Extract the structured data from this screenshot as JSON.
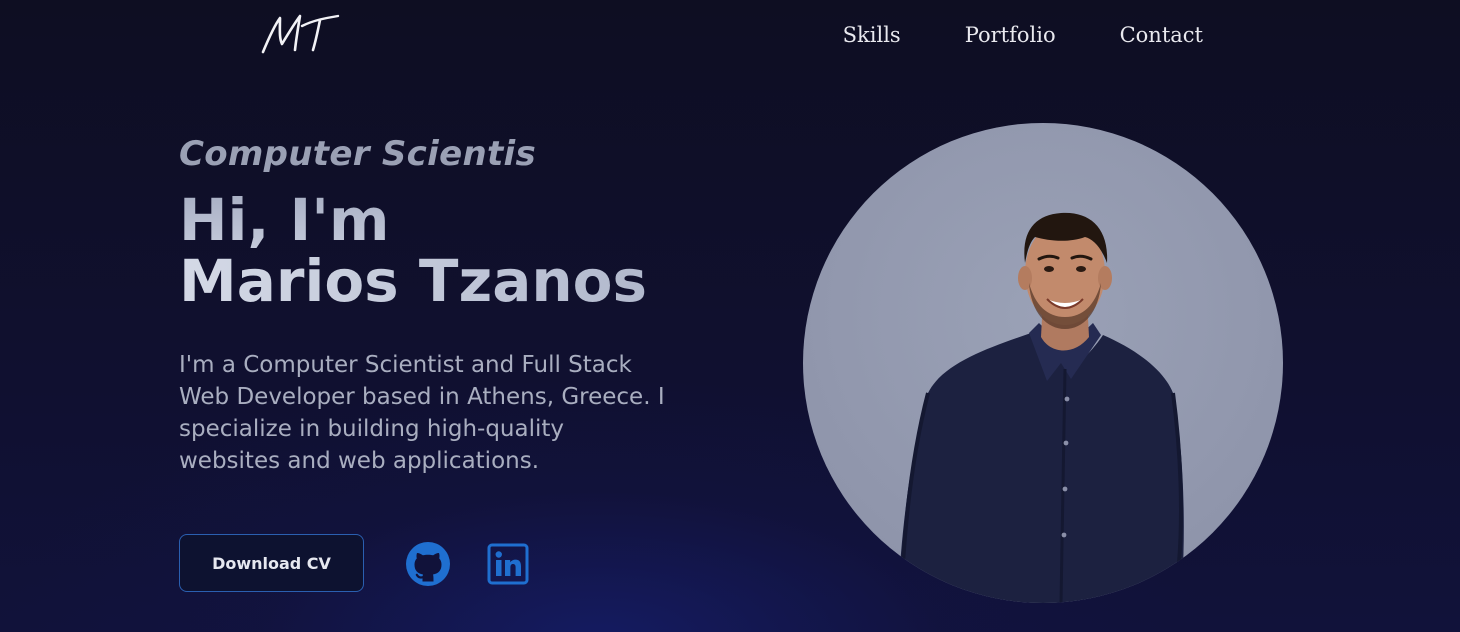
{
  "header": {
    "logo_text": "MT",
    "nav": [
      {
        "label": "Skills"
      },
      {
        "label": "Portfolio"
      },
      {
        "label": "Contact"
      }
    ]
  },
  "hero": {
    "subtitle": "Computer Scientis",
    "greeting": "Hi, I'm",
    "name": "Marios Tzanos",
    "intro": "I'm a Computer Scientist and Full Stack Web Developer based in Athens, Greece. I specialize in building high-quality websites and web applications.",
    "cv_button": "Download CV",
    "social": [
      {
        "icon": "github-icon"
      },
      {
        "icon": "linkedin-icon"
      }
    ]
  },
  "colors": {
    "background": "#0f0f26",
    "accent_blue": "#1f6fd0",
    "heading_gray": "#b8bfd2",
    "portrait_bg": "#9197ad"
  }
}
